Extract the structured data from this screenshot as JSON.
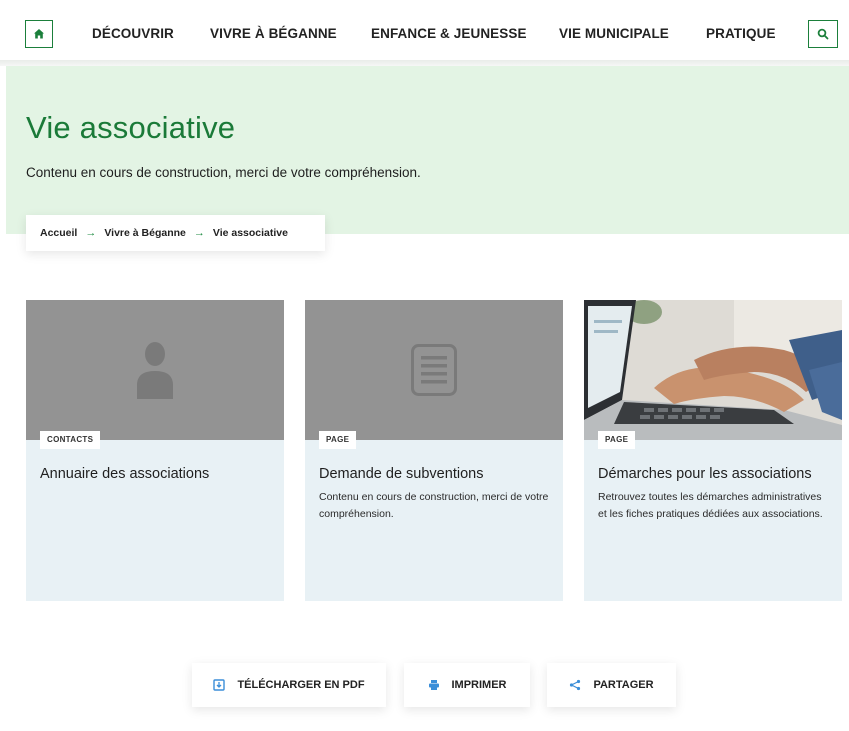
{
  "header": {
    "home_icon": "home-icon",
    "search_icon": "search-icon",
    "accent": "#1b7f3b",
    "nav": [
      {
        "label": "DÉCOUVRIR"
      },
      {
        "label": "VIVRE À BÉGANNE"
      },
      {
        "label": "ENFANCE & JEUNESSE"
      },
      {
        "label": "VIE MUNICIPALE"
      },
      {
        "label": "PRATIQUE"
      }
    ]
  },
  "hero": {
    "title": "Vie associative",
    "subtitle": "Contenu en cours de construction, merci de votre compréhension.",
    "background": "#e3f4e4"
  },
  "breadcrumb": {
    "items": [
      "Accueil",
      "Vivre à Béganne",
      "Vie associative"
    ],
    "separator": "→"
  },
  "cards": [
    {
      "tag": "CONTACTS",
      "title": "Annuaire des associations",
      "description": "",
      "media": "person-icon"
    },
    {
      "tag": "PAGE",
      "title": "Demande de subventions",
      "description": "Contenu en cours de construction, merci de votre compréhension.",
      "media": "document-icon"
    },
    {
      "tag": "PAGE",
      "title": "Démarches pour les associations",
      "description": "Retrouvez toutes les démarches administratives et les fiches pratiques dédiées aux associations.",
      "media": "laptop-typing-photo"
    }
  ],
  "actions": [
    {
      "label": "TÉLÉCHARGER EN PDF",
      "icon": "download-pdf-icon"
    },
    {
      "label": "IMPRIMER",
      "icon": "printer-icon"
    },
    {
      "label": "PARTAGER",
      "icon": "share-icon"
    }
  ],
  "colors": {
    "card_bg": "#e8f1f5",
    "media_placeholder": "#939393",
    "icon_blue": "#3b8ed8"
  }
}
